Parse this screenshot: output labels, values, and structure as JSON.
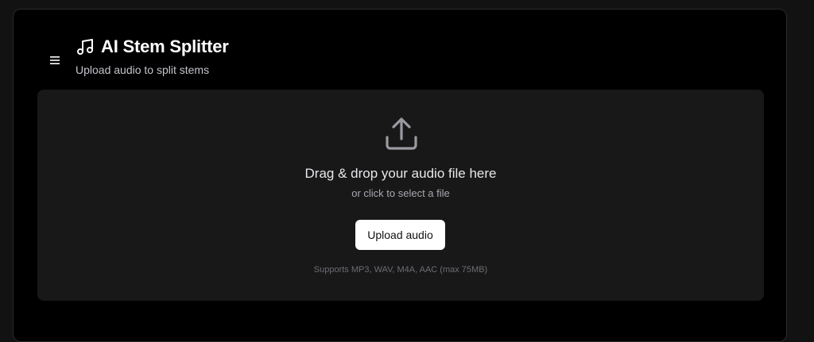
{
  "header": {
    "menu_icon": "hamburger-menu-icon",
    "title_icon": "music-note-icon",
    "title": "AI Stem Splitter",
    "subtitle": "Upload audio to split stems"
  },
  "dropzone": {
    "icon": "upload-icon",
    "title": "Drag & drop your audio file here",
    "subtitle": "or click to select a file",
    "button_label": "Upload audio",
    "supports_note": "Supports MP3, WAV, M4A, AAC (max 75MB)"
  },
  "colors": {
    "page_background": "#121212",
    "panel_background": "#000000",
    "dropzone_background": "#181818",
    "button_background": "#ffffff"
  }
}
